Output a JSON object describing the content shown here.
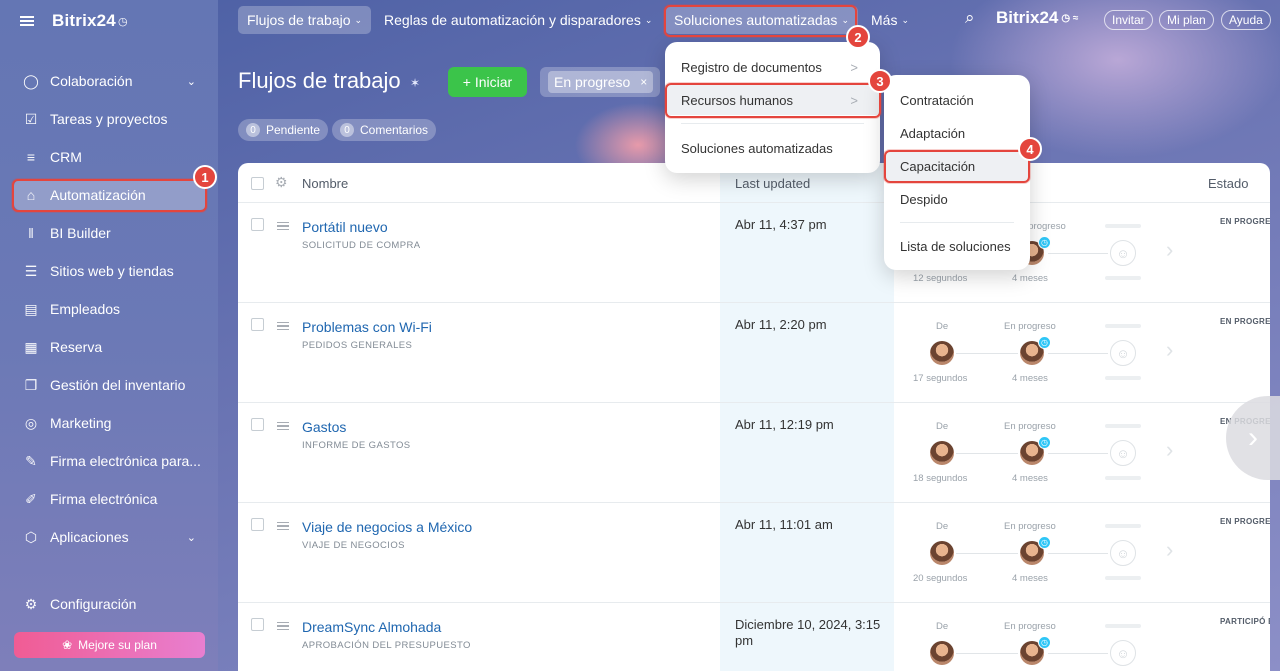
{
  "brand": {
    "name": "Bitrix24",
    "clock": "◷"
  },
  "sidebar": {
    "items": [
      {
        "label": "Colaboración",
        "icon": "chat-icon",
        "glyph": "◯",
        "chevron": "⌄"
      },
      {
        "label": "Tareas y proyectos",
        "icon": "tasks-icon",
        "glyph": "☑"
      },
      {
        "label": "CRM",
        "icon": "crm-icon",
        "glyph": "≡"
      },
      {
        "label": "Automatización",
        "icon": "robot-icon",
        "glyph": "⌂"
      },
      {
        "label": "BI Builder",
        "icon": "chart-icon",
        "glyph": "‖"
      },
      {
        "label": "Sitios web y tiendas",
        "icon": "cart-icon",
        "glyph": "☰"
      },
      {
        "label": "Empleados",
        "icon": "employees-icon",
        "glyph": "▤"
      },
      {
        "label": "Reserva",
        "icon": "calendar-icon",
        "glyph": "▦"
      },
      {
        "label": "Gestión del inventario",
        "icon": "inventory-icon",
        "glyph": "❐"
      },
      {
        "label": "Marketing",
        "icon": "target-icon",
        "glyph": "◎"
      },
      {
        "label": "Firma electrónica para...",
        "icon": "document-sign-icon",
        "glyph": "✎"
      },
      {
        "label": "Firma electrónica",
        "icon": "sign-icon",
        "glyph": "✐"
      },
      {
        "label": "Aplicaciones",
        "icon": "apps-icon",
        "glyph": "⬡",
        "chevron": "⌄"
      }
    ],
    "settings": {
      "label": "Configuración",
      "icon": "gear-icon",
      "glyph": "⚙"
    },
    "upgrade": {
      "label": "Mejore su plan",
      "glyph": "❀"
    }
  },
  "topbar": {
    "tabs": [
      {
        "label": "Flujos de trabajo",
        "dd": "⌄"
      },
      {
        "label": "Reglas de automatización y disparadores",
        "dd": "⌄"
      },
      {
        "label": "Soluciones automatizadas",
        "dd": "⌄"
      },
      {
        "label": "Más",
        "dd": "⌄"
      }
    ],
    "search_glyph": "⌕",
    "brand": "Bitrix24",
    "brand_marks": "◷ ≈",
    "pills": [
      "Invitar",
      "Mi plan",
      "Ayuda"
    ]
  },
  "header": {
    "title": "Flujos de trabajo",
    "pin_glyph": "✶",
    "start_label": "+ Iniciar",
    "filter_chip": "En progreso",
    "filter_close": "×",
    "counters": [
      {
        "count": "0",
        "label": "Pendiente"
      },
      {
        "count": "0",
        "label": "Comentarios"
      }
    ]
  },
  "table": {
    "columns": {
      "name": "Nombre",
      "updated": "Last updated",
      "status": "Estado"
    },
    "gear_glyph": "⚙",
    "rows": [
      {
        "title": "Portátil nuevo",
        "subtitle": "SOLICITUD DE COMPRA",
        "date": "Abr 11, 4:37 pm",
        "from": "",
        "in_progress": "En progreso",
        "from_time": "12 segundos",
        "progress_time": "4 meses",
        "state": "EN PROGRESO"
      },
      {
        "title": "Problemas con Wi-Fi",
        "subtitle": "PEDIDOS GENERALES",
        "date": "Abr 11, 2:20 pm",
        "from": "De",
        "in_progress": "En progreso",
        "from_time": "17 segundos",
        "progress_time": "4 meses",
        "state": "EN PROGRESO"
      },
      {
        "title": "Gastos",
        "subtitle": "INFORME DE GASTOS",
        "date": "Abr 11, 12:19 pm",
        "from": "De",
        "in_progress": "En progreso",
        "from_time": "18 segundos",
        "progress_time": "4 meses",
        "state": "EN PROGRESO"
      },
      {
        "title": "Viaje de negocios a México",
        "subtitle": "VIAJE DE NEGOCIOS",
        "date": "Abr 11, 11:01 am",
        "from": "De",
        "in_progress": "En progreso",
        "from_time": "20 segundos",
        "progress_time": "4 meses",
        "state": "EN PROGRESO"
      },
      {
        "title": "DreamSync Almohada",
        "subtitle": "APROBACIÓN DEL PRESUPUESTO",
        "date": "Diciembre 10, 2024, 3:15 pm",
        "from": "De",
        "in_progress": "En progreso",
        "from_time": "",
        "progress_time": "",
        "state": "PARTICIPÓ EN"
      }
    ]
  },
  "menu1": {
    "items": [
      "Registro de documentos",
      "Recursos humanos",
      "Soluciones automatizadas"
    ],
    "chevron": ">"
  },
  "menu2": {
    "items": [
      "Contratación",
      "Adaptación",
      "Capacitación",
      "Despido",
      "Lista de soluciones"
    ]
  },
  "callouts": [
    "1",
    "2",
    "3",
    "4"
  ],
  "icons": {
    "person": "☺",
    "next": "›",
    "clock": "◷"
  },
  "colors": {
    "accent": "#e4453d",
    "start_button": "#3bc44a",
    "link": "#2067b0",
    "progress_clock": "#2fc6f6"
  }
}
